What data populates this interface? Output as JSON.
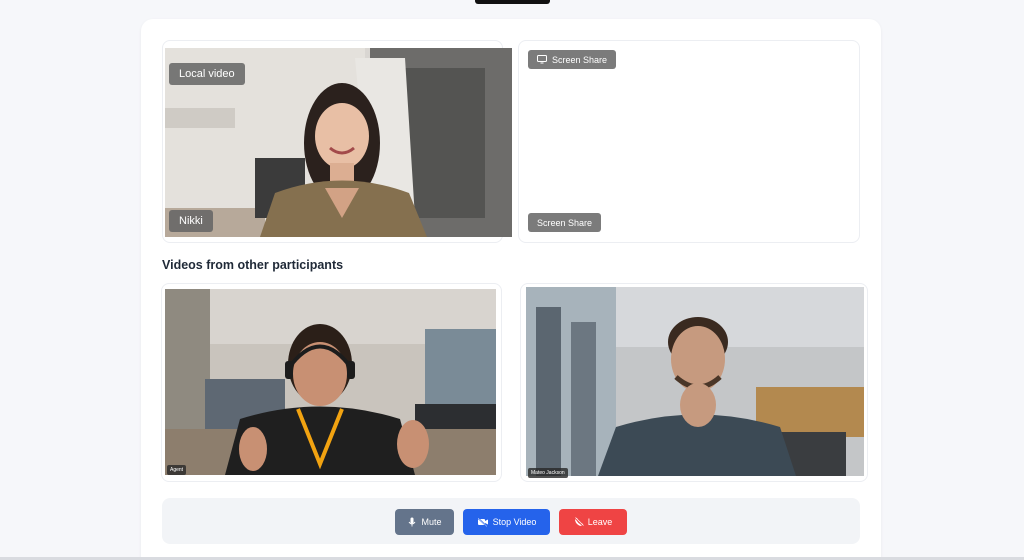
{
  "local": {
    "heading": "Local video",
    "name": "Nikki"
  },
  "screen_share": {
    "top_label": "Screen Share",
    "bottom_label": "Screen Share"
  },
  "participants": {
    "title": "Videos from other participants",
    "items": [
      {
        "name": "Agent"
      },
      {
        "name": "Mateo Jackson"
      }
    ]
  },
  "controls": {
    "mute_label": "Mute",
    "stop_video_label": "Stop Video",
    "leave_label": "Leave"
  },
  "colors": {
    "mute": "#64748b",
    "stop_video": "#2563eb",
    "leave": "#ef4444"
  }
}
